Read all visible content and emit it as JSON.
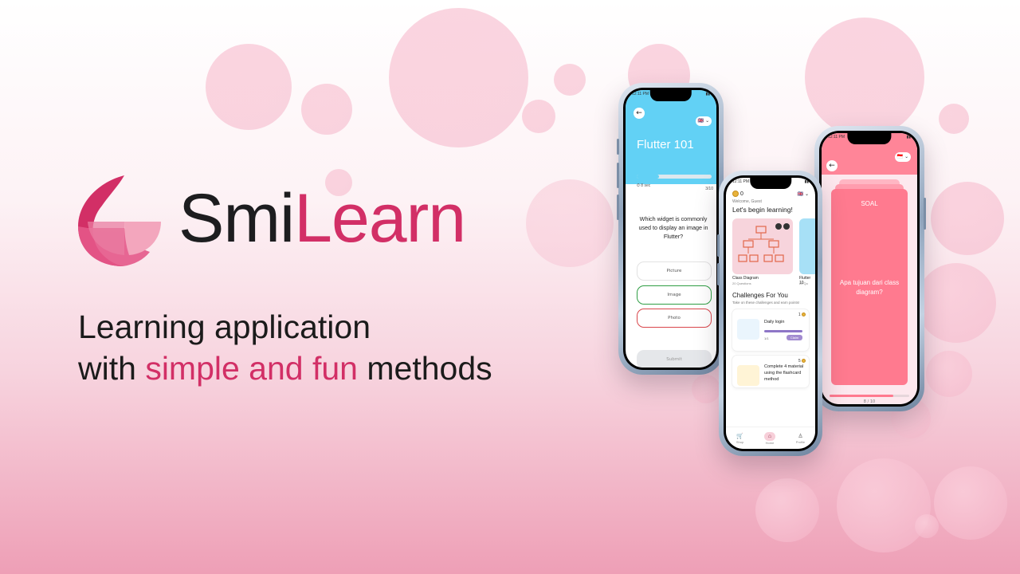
{
  "brand": {
    "name_part1": "Smi",
    "name_part2": "Learn",
    "colors": {
      "primary": "#d22f66",
      "dark": "#1d1d1f",
      "light_pink": "#f3a6bd"
    }
  },
  "tagline": {
    "line1": "Learning application",
    "line2_start": "with ",
    "line2_accent": "simple and fun",
    "line2_end": " methods"
  },
  "phone_quiz": {
    "status_time": "12:11 PM",
    "back_icon": "arrow-left-icon",
    "flag": "🇬🇧 ⌄",
    "title": "Flutter 101",
    "timer": "⏱ 8 sec",
    "question_count": "3/10",
    "progress": 0.3,
    "question": "Which widget is commonly used to display an image in Flutter?",
    "options": [
      "Picture",
      "Image",
      "Photo"
    ],
    "submit_label": "Submit"
  },
  "phone_home": {
    "status_time": "12:11 PM",
    "coins": "0",
    "flag": "🇬🇧 ⌄",
    "welcome": "Welcome, Guest",
    "heading": "Let's begin learning!",
    "course_cards": [
      {
        "title": "Class Diagram",
        "sub": "20 Questions"
      },
      {
        "title": "Flutter 10",
        "sub": "20 Qu"
      }
    ],
    "challenges_heading": "Challenges For You",
    "challenges_sub": "Take on these challenges and earn points!",
    "challenges": [
      {
        "title": "Daily login",
        "points": "1",
        "progress_text": "1/1",
        "claim": "Claim",
        "progress": 1.0
      },
      {
        "title": "Complete 4 material using the flashcard method",
        "points": "5"
      }
    ],
    "nav": [
      {
        "label": "Shop",
        "icon": "cart-icon"
      },
      {
        "label": "Home",
        "icon": "home-icon"
      },
      {
        "label": "Profile",
        "icon": "person-icon"
      }
    ]
  },
  "phone_flashcard": {
    "status_time": "12:11 PM",
    "flag": "🇮🇩 ⌄",
    "card_header": "SOAL",
    "question": "Apa tujuan dari class diagram?",
    "counter": "8 / 10",
    "progress": 0.8
  }
}
